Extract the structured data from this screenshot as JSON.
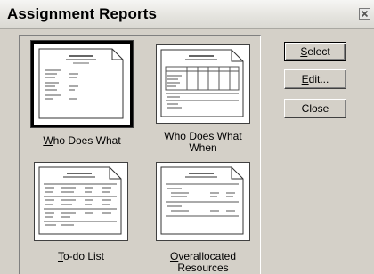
{
  "window": {
    "title": "Assignment Reports"
  },
  "reports": [
    {
      "label_access": "W",
      "label_rest": "ho Does What",
      "line2": "",
      "selected": true
    },
    {
      "label_pre": "Who ",
      "label_access": "D",
      "label_post": "oes What",
      "line2": "When",
      "selected": false
    },
    {
      "label_access": "T",
      "label_rest": "o-do List",
      "line2": "",
      "selected": false
    },
    {
      "label_access": "O",
      "label_rest": "verallocated",
      "line2": "Resources",
      "selected": false
    }
  ],
  "buttons": {
    "select_access": "S",
    "select_rest": "elect",
    "edit_access": "E",
    "edit_rest": "dit...",
    "close": "Close"
  },
  "icons": {
    "close": "close-x-icon",
    "report": "report-page-icon"
  }
}
